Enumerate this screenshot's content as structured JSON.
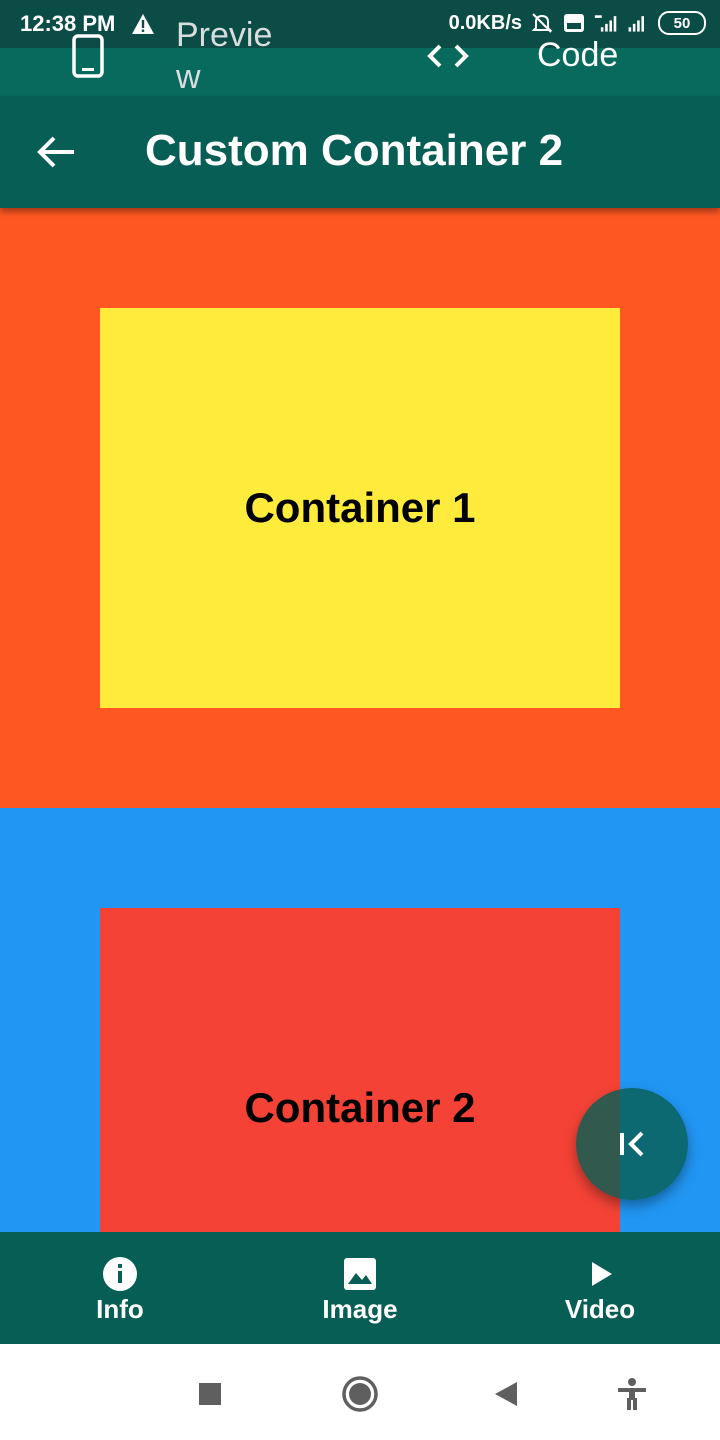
{
  "status_bar": {
    "time": "12:38 PM",
    "network_speed": "0.0KB/s",
    "battery": "50",
    "icons": [
      "warning-icon",
      "mute-icon",
      "volte-icon",
      "signal-4g-icon",
      "signal-icon",
      "battery-icon"
    ]
  },
  "top_tabs": {
    "preview_label": "Preview",
    "code_label": "Code",
    "icons": [
      "phone-icon",
      "code-icon"
    ]
  },
  "app_bar": {
    "title": "Custom Container 2",
    "back_icon": "arrow-left-icon"
  },
  "content": {
    "container1_label": "Container 1",
    "container2_label": "Container 2"
  },
  "fab": {
    "icon": "collapse-left-icon"
  },
  "bottom_nav": {
    "items": [
      {
        "label": "Info",
        "icon": "info-icon"
      },
      {
        "label": "Image",
        "icon": "image-icon"
      },
      {
        "label": "Video",
        "icon": "play-icon"
      }
    ]
  },
  "system_nav": {
    "icons": [
      "recents-square-icon",
      "home-circle-icon",
      "back-triangle-icon",
      "accessibility-icon"
    ]
  },
  "colors": {
    "app_bar": "#075e54",
    "outer_container1": "#ff5722",
    "inner_container1": "#ffeb3b",
    "outer_container2": "#2196f3",
    "inner_container2": "#f44336"
  }
}
